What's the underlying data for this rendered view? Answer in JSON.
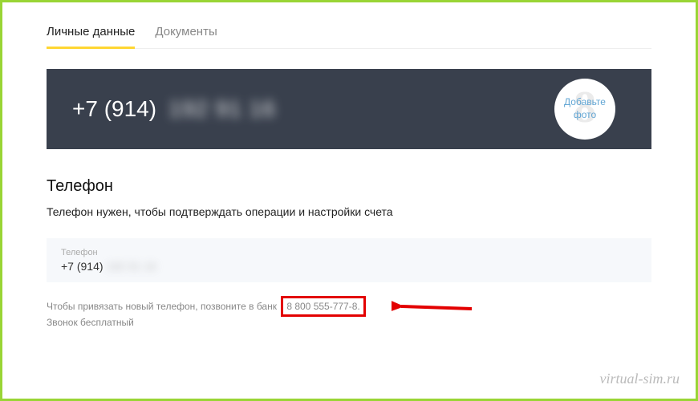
{
  "tabs": {
    "personal": "Личные данные",
    "documents": "Документы"
  },
  "hero": {
    "phone_prefix": "+7 (914)",
    "phone_masked": "192 91 16",
    "avatar_line1": "Добавьте",
    "avatar_line2": "фото"
  },
  "section": {
    "title": "Телефон",
    "desc": "Телефон нужен, чтобы подтверждать операции и настройки счета"
  },
  "field": {
    "label": "Телефон",
    "value_prefix": "+7 (914)",
    "value_masked": "192 91 16"
  },
  "hint": {
    "before_box": "Чтобы привязать новый телефон, позвоните в банк",
    "boxed": "8 800 555-777-8.",
    "line2": "Звонок бесплатный"
  },
  "watermark": "virtual-sim.ru"
}
